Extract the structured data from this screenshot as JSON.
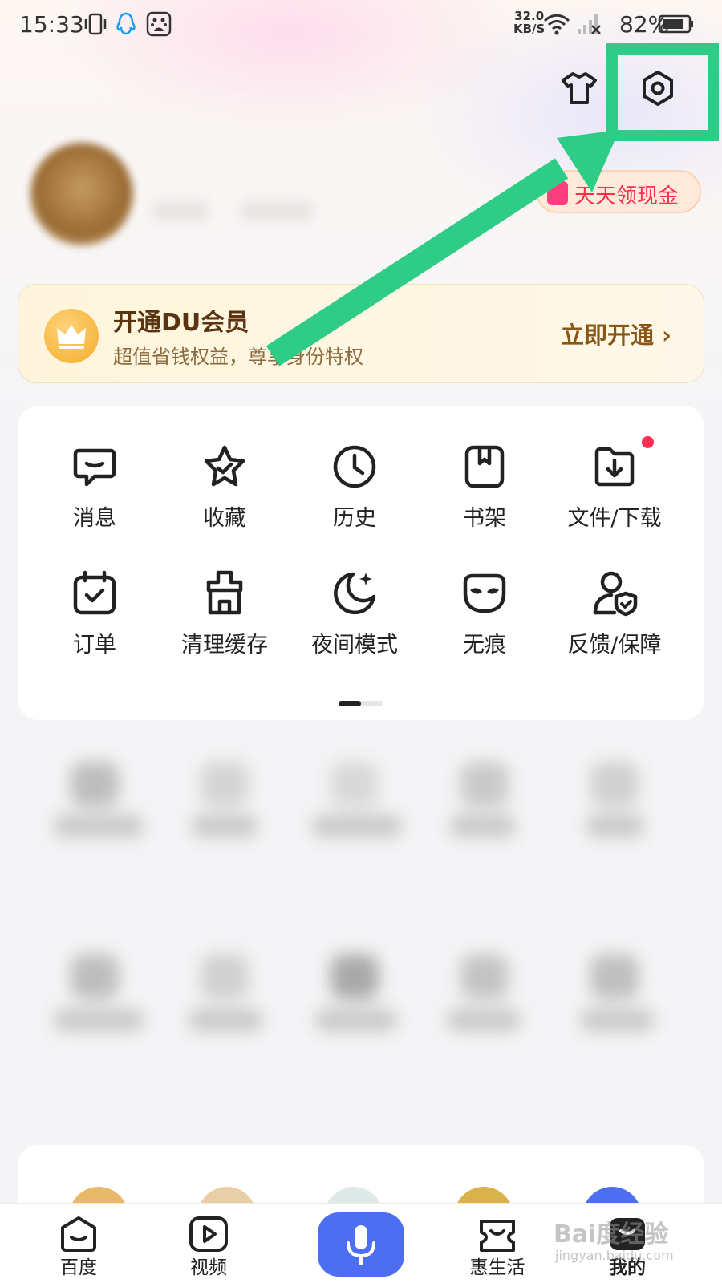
{
  "status_bar": {
    "time": "15:33",
    "net_speed": "32.0",
    "net_unit": "KB/S",
    "battery": "82%"
  },
  "header": {
    "icons": [
      "skin-icon",
      "settings-icon"
    ],
    "highlight_color": "#2ecc86"
  },
  "profile": {
    "cash_button": "天天领现金"
  },
  "membership": {
    "title": "开通DU会员",
    "subtitle": "超值省钱权益，尊享身份特权",
    "action": "立即开通 ›"
  },
  "functions": [
    {
      "label": "消息",
      "icon": "message-icon"
    },
    {
      "label": "收藏",
      "icon": "star-icon"
    },
    {
      "label": "历史",
      "icon": "clock-icon"
    },
    {
      "label": "书架",
      "icon": "bookshelf-icon"
    },
    {
      "label": "文件/下载",
      "icon": "download-icon"
    },
    {
      "label": "订单",
      "icon": "order-icon"
    },
    {
      "label": "清理缓存",
      "icon": "clean-cache-icon"
    },
    {
      "label": "夜间模式",
      "icon": "night-mode-icon"
    },
    {
      "label": "无痕",
      "icon": "incognito-icon"
    },
    {
      "label": "反馈/保障",
      "icon": "feedback-icon"
    }
  ],
  "tabs": [
    {
      "label": "百度",
      "icon": "baidu-icon"
    },
    {
      "label": "视频",
      "icon": "video-icon"
    },
    {
      "label": "",
      "icon": "mic-icon"
    },
    {
      "label": "惠生活",
      "icon": "life-icon"
    },
    {
      "label": "我的",
      "icon": "mine-icon"
    }
  ],
  "watermark": {
    "main": "Bai度经验",
    "sub": "jingyan.baidu.com"
  },
  "colors": {
    "accent": "#4e6ef2",
    "cash_red": "#ff2e4d",
    "member_brown": "#5a3410",
    "badge_red": "#ff2d55"
  }
}
